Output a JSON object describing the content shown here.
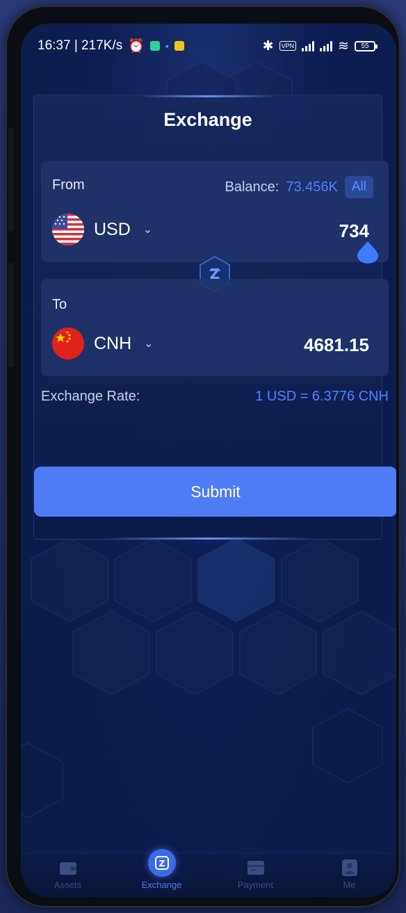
{
  "status_bar": {
    "time_speed": "16:37 | 217K/s",
    "vpn_label": "VPN",
    "battery": "55"
  },
  "exchange": {
    "title": "Exchange",
    "from": {
      "label": "From",
      "balance_label": "Balance:",
      "balance_value": "73.456K",
      "all_label": "All",
      "currency": "USD",
      "amount": "734"
    },
    "to": {
      "label": "To",
      "currency": "CNH",
      "amount": "4681.15"
    },
    "rate_label": "Exchange Rate:",
    "rate_value": "1 USD = 6.3776 CNH",
    "submit_label": "Submit"
  },
  "bottom_nav": {
    "items": [
      {
        "label": "Assets",
        "icon": "wallet-icon"
      },
      {
        "label": "Exchange",
        "icon": "exchange-icon"
      },
      {
        "label": "Payment",
        "icon": "card-icon"
      },
      {
        "label": "Me",
        "icon": "user-icon"
      }
    ],
    "active_index": 1
  },
  "colors": {
    "accent": "#4d7cf5",
    "link_blue": "#4d84ff",
    "background": "#0f1f55"
  }
}
